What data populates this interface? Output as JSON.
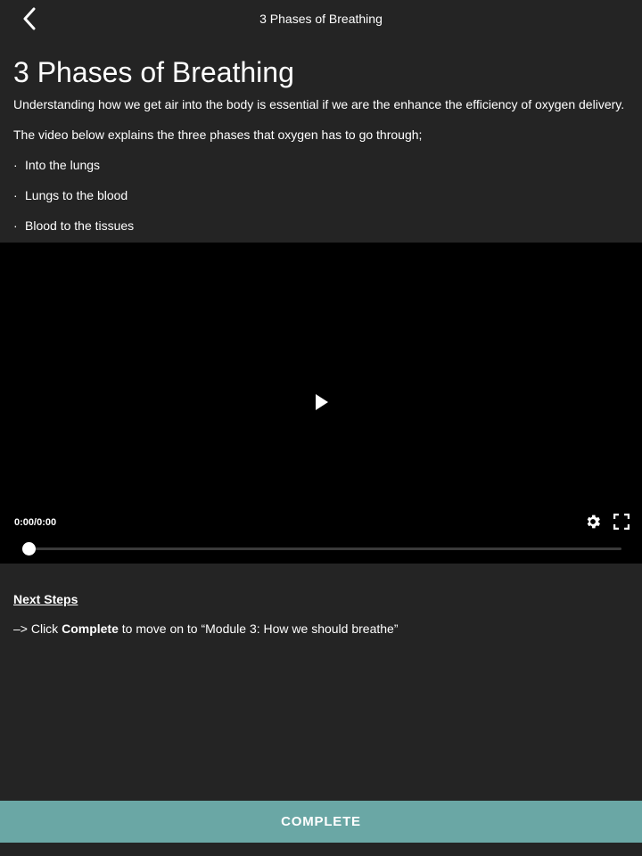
{
  "header": {
    "back_icon": "chevron-left-icon",
    "title": "3 Phases of Breathing"
  },
  "main": {
    "title": "3 Phases of Breathing",
    "intro": "Understanding how we get air into the body is essential if we are the enhance the efficiency of oxygen delivery.",
    "video_intro": "The video below explains the three phases that oxygen has to go through;",
    "bullet_char": "·",
    "bullets": [
      "Into the lungs",
      "Lungs to the blood",
      "Blood to the tissues"
    ]
  },
  "video": {
    "play_icon": "play-icon",
    "time": "0:00/0:00",
    "progress_fraction": 0,
    "settings_icon": "gear-icon",
    "fullscreen_icon": "fullscreen-icon"
  },
  "next_steps": {
    "heading": "Next Steps",
    "prefix": "–> Click ",
    "bold": "Complete",
    "suffix": " to move on to “Module 3: How we should breathe”"
  },
  "footer": {
    "complete_label": "COMPLETE"
  },
  "colors": {
    "background": "#242424",
    "video_background": "#000000",
    "accent": "#6aa7a5"
  }
}
